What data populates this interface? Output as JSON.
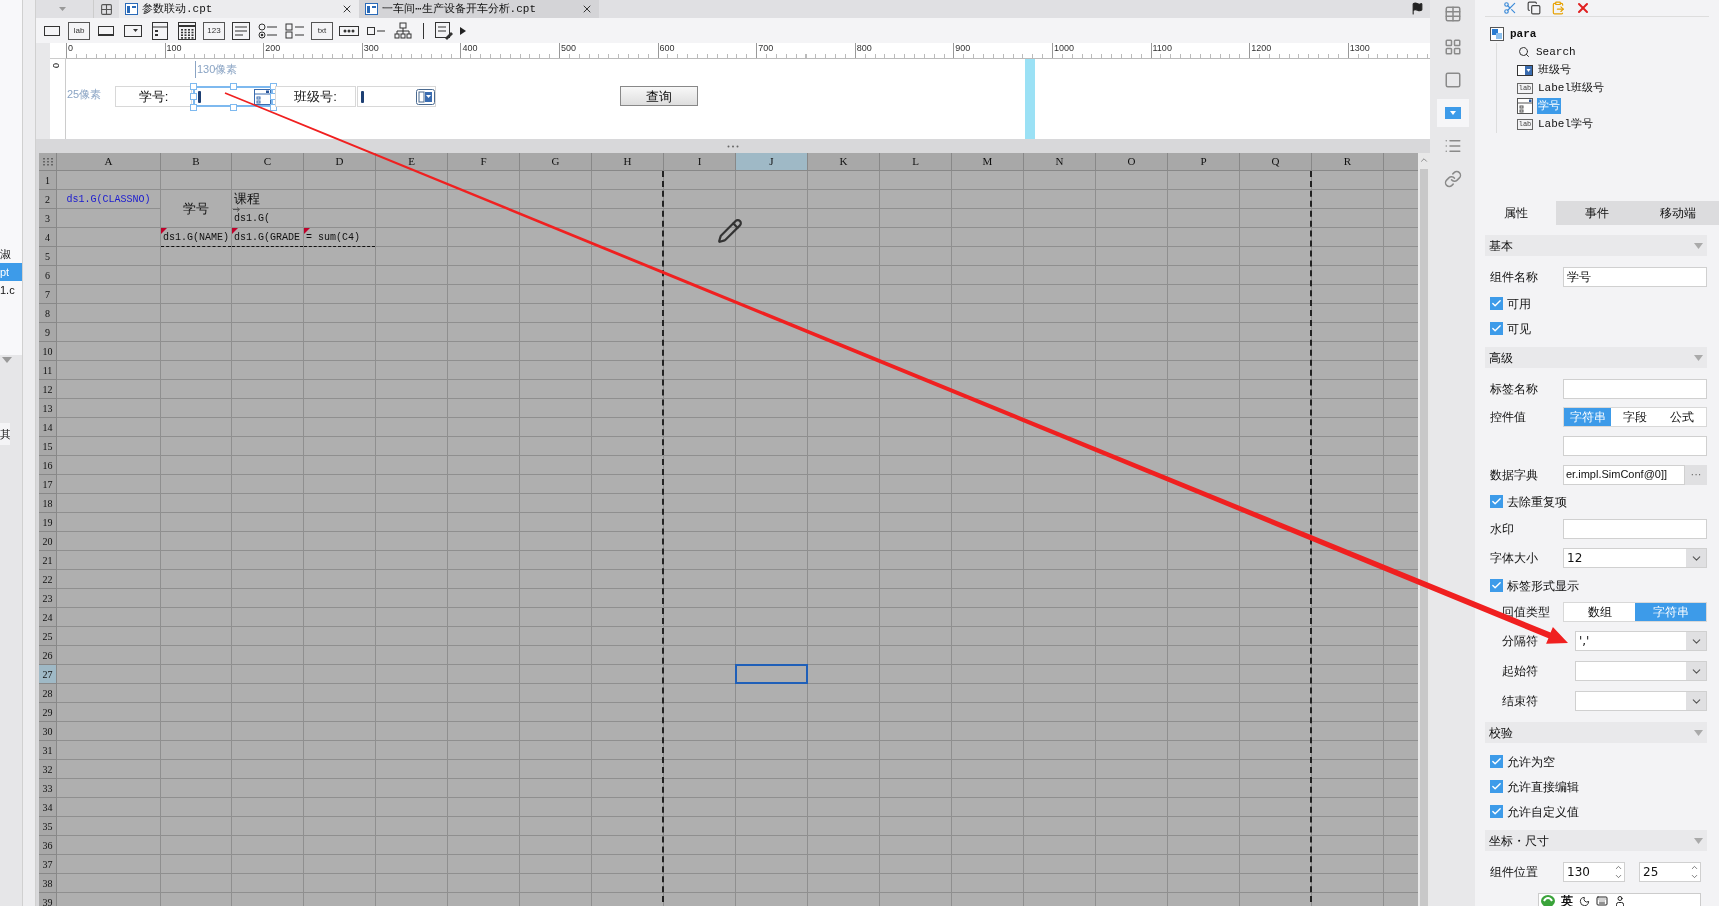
{
  "left_panel": {
    "items": [
      {
        "text": "淑",
        "selected": false
      },
      {
        "text": "pt",
        "selected": true
      },
      {
        "text": "1.c",
        "selected": false
      }
    ],
    "footer": "其"
  },
  "tabs": [
    {
      "title": "参数联动.cpt",
      "selected": true
    },
    {
      "title": "一车间⋯生产设备开车分析.cpt",
      "selected": false
    }
  ],
  "toolbar": [
    {
      "kind": "textbox"
    },
    {
      "kind": "label",
      "text": "lab"
    },
    {
      "kind": "button"
    },
    {
      "kind": "combo"
    },
    {
      "kind": "datefield"
    },
    {
      "kind": "calendar"
    },
    {
      "kind": "number",
      "text": "123"
    },
    {
      "kind": "textarea"
    },
    {
      "kind": "radio"
    },
    {
      "kind": "checkgroup"
    },
    {
      "kind": "text",
      "text": "txt"
    },
    {
      "kind": "password"
    },
    {
      "kind": "checkbox"
    },
    {
      "kind": "tree"
    },
    {
      "kind": "separator"
    },
    {
      "kind": "multifile"
    },
    {
      "kind": "more"
    }
  ],
  "parameter_panel": {
    "ruler_labels": [
      "0",
      "100",
      "200",
      "300",
      "400",
      "500",
      "600",
      "700",
      "800",
      "900",
      "1000",
      "1100",
      "1200",
      "1300"
    ],
    "vertical_ruler_label": "0",
    "width_hint": "130像素",
    "height_hint": "25像素",
    "widgets": [
      {
        "kind": "label",
        "text": "学号:",
        "selected": false
      },
      {
        "kind": "datefield",
        "selected": true
      },
      {
        "kind": "label",
        "text": "班级号:",
        "selected": false
      },
      {
        "kind": "combo",
        "selected": false
      },
      {
        "kind": "button",
        "text": "查询",
        "selected": false
      }
    ]
  },
  "sheet": {
    "columns": [
      {
        "label": "A",
        "selected": false,
        "page_break": false
      },
      {
        "label": "B",
        "selected": false,
        "page_break": false
      },
      {
        "label": "C",
        "selected": false,
        "page_break": false
      },
      {
        "label": "D",
        "selected": false,
        "page_break": false
      },
      {
        "label": "E",
        "selected": false,
        "page_break": false
      },
      {
        "label": "F",
        "selected": false,
        "page_break": false
      },
      {
        "label": "G",
        "selected": false,
        "page_break": false
      },
      {
        "label": "H",
        "selected": false,
        "page_break": true
      },
      {
        "label": "I",
        "selected": false,
        "page_break": false
      },
      {
        "label": "J",
        "selected": true,
        "page_break": false
      },
      {
        "label": "K",
        "selected": false,
        "page_break": false
      },
      {
        "label": "L",
        "selected": false,
        "page_break": false
      },
      {
        "label": "M",
        "selected": false,
        "page_break": false
      },
      {
        "label": "N",
        "selected": false,
        "page_break": false
      },
      {
        "label": "O",
        "selected": false,
        "page_break": false
      },
      {
        "label": "P",
        "selected": false,
        "page_break": false
      },
      {
        "label": "Q",
        "selected": false,
        "page_break": true
      },
      {
        "label": "R",
        "selected": false,
        "page_break": false
      }
    ],
    "rows": [
      {
        "label": "1",
        "selected": false
      },
      {
        "label": "2",
        "selected": false,
        "cells": [
          {
            "kind": "formula",
            "text": "ds1.G(CLASSNO)",
            "color": "#1a1ad0",
            "marked": false,
            "expand": false
          },
          {
            "kind": "label-span",
            "text": "学号"
          },
          {
            "kind": "label",
            "text": "课程"
          }
        ]
      },
      {
        "label": "3",
        "selected": false,
        "cells": [
          {
            "kind": "empty"
          },
          {
            "kind": "covered"
          },
          {
            "kind": "formula",
            "text": "ds1.G(",
            "marked": false,
            "expand": true
          }
        ]
      },
      {
        "label": "4",
        "selected": false,
        "cells": [
          {
            "kind": "empty"
          },
          {
            "kind": "formula",
            "text": "ds1.G(NAME)",
            "marked": true,
            "expand": false
          },
          {
            "kind": "formula",
            "text": "ds1.G(GRADE",
            "marked": true,
            "expand": false
          },
          {
            "kind": "formula",
            "text": "= sum(C4)",
            "marked": true,
            "expand": false
          }
        ]
      },
      {
        "label": "5",
        "selected": false
      },
      {
        "label": "6",
        "selected": false
      },
      {
        "label": "7",
        "selected": false
      },
      {
        "label": "8",
        "selected": false
      },
      {
        "label": "9",
        "selected": false
      },
      {
        "label": "10",
        "selected": false
      },
      {
        "label": "11",
        "selected": false
      },
      {
        "label": "12",
        "selected": false
      },
      {
        "label": "13",
        "selected": false
      },
      {
        "label": "14",
        "selected": false
      },
      {
        "label": "15",
        "selected": false
      },
      {
        "label": "16",
        "selected": false
      },
      {
        "label": "17",
        "selected": false
      },
      {
        "label": "18",
        "selected": false
      },
      {
        "label": "19",
        "selected": false
      },
      {
        "label": "20",
        "selected": false
      },
      {
        "label": "21",
        "selected": false
      },
      {
        "label": "22",
        "selected": false
      },
      {
        "label": "23",
        "selected": false
      },
      {
        "label": "24",
        "selected": false
      },
      {
        "label": "25",
        "selected": false
      },
      {
        "label": "26",
        "selected": false
      },
      {
        "label": "27",
        "selected": true
      },
      {
        "label": "28",
        "selected": false
      },
      {
        "label": "29",
        "selected": false
      },
      {
        "label": "30",
        "selected": false
      },
      {
        "label": "31",
        "selected": false
      },
      {
        "label": "32",
        "selected": false
      },
      {
        "label": "33",
        "selected": false
      },
      {
        "label": "34",
        "selected": false
      },
      {
        "label": "35",
        "selected": false
      },
      {
        "label": "36",
        "selected": false
      },
      {
        "label": "37",
        "selected": false
      },
      {
        "label": "38",
        "selected": false
      },
      {
        "label": "39",
        "selected": false
      }
    ]
  },
  "side_tools": [
    {
      "kind": "grid",
      "selected": false
    },
    {
      "kind": "grid-info",
      "selected": false
    },
    {
      "kind": "frame",
      "selected": false
    },
    {
      "kind": "dropdown",
      "selected": true
    },
    {
      "kind": "form",
      "selected": false
    },
    {
      "kind": "link",
      "selected": false
    }
  ],
  "widget_tree": {
    "label": "para",
    "children": [
      {
        "kind": "search",
        "label": "Search",
        "selected": false
      },
      {
        "kind": "combo",
        "label": "班级号",
        "selected": false
      },
      {
        "kind": "label",
        "icon_text": "lab",
        "label": "Label班级号",
        "selected": false
      },
      {
        "kind": "datefield",
        "label": "学号",
        "selected": true
      },
      {
        "kind": "label",
        "icon_text": "lab",
        "label": "Label学号",
        "selected": false
      }
    ]
  },
  "property_tabs": [
    {
      "label": "属性",
      "selected": true
    },
    {
      "label": "事件",
      "selected": false
    },
    {
      "label": "移动端",
      "selected": false
    }
  ],
  "sections": [
    {
      "title": "基本",
      "expanded": true,
      "fields": [
        {
          "kind": "text",
          "label": "组件名称",
          "value": "学号"
        },
        {
          "kind": "check",
          "label": "可用",
          "checked": true
        },
        {
          "kind": "check",
          "label": "可见",
          "checked": true
        }
      ]
    },
    {
      "title": "高级",
      "expanded": true,
      "fields": [
        {
          "kind": "text",
          "label": "标签名称"
        },
        {
          "kind": "segmented",
          "label": "控件值",
          "options": [
            {
              "label": "字符串",
              "selected": true
            },
            {
              "label": "字段",
              "selected": false
            },
            {
              "label": "公式",
              "selected": false
            }
          ]
        },
        {
          "kind": "text"
        },
        {
          "kind": "dict",
          "label": "数据字典",
          "value": "er.impl.SimConf@0]]",
          "button": "···"
        },
        {
          "kind": "check",
          "label": "去除重复项",
          "checked": true
        },
        {
          "kind": "text",
          "label": "水印"
        },
        {
          "kind": "select",
          "label": "字体大小",
          "value": "12"
        },
        {
          "kind": "check",
          "label": "标签形式显示",
          "checked": true
        },
        {
          "kind": "segmented",
          "label": "回值类型",
          "label_partly_hidden": true,
          "options": [
            {
              "label": "数组",
              "selected": false
            },
            {
              "label": "字符串",
              "selected": true
            }
          ]
        },
        {
          "kind": "subselect",
          "label": "分隔符",
          "value": "','"
        },
        {
          "kind": "subselect",
          "label": "起始符"
        },
        {
          "kind": "subselect",
          "label": "结束符"
        }
      ]
    },
    {
      "title": "校验",
      "expanded": true,
      "fields": [
        {
          "kind": "check",
          "label": "允许为空",
          "checked": true
        },
        {
          "kind": "check",
          "label": "允许直接编辑",
          "checked": true
        },
        {
          "kind": "check",
          "label": "允许自定义值",
          "checked": true
        }
      ]
    },
    {
      "title": "坐标・尺寸",
      "expanded": true,
      "fields": [
        {
          "kind": "spinners",
          "label": "组件位置",
          "values": [
            "130",
            "25"
          ]
        }
      ]
    }
  ],
  "ime": {
    "mode": "英"
  }
}
